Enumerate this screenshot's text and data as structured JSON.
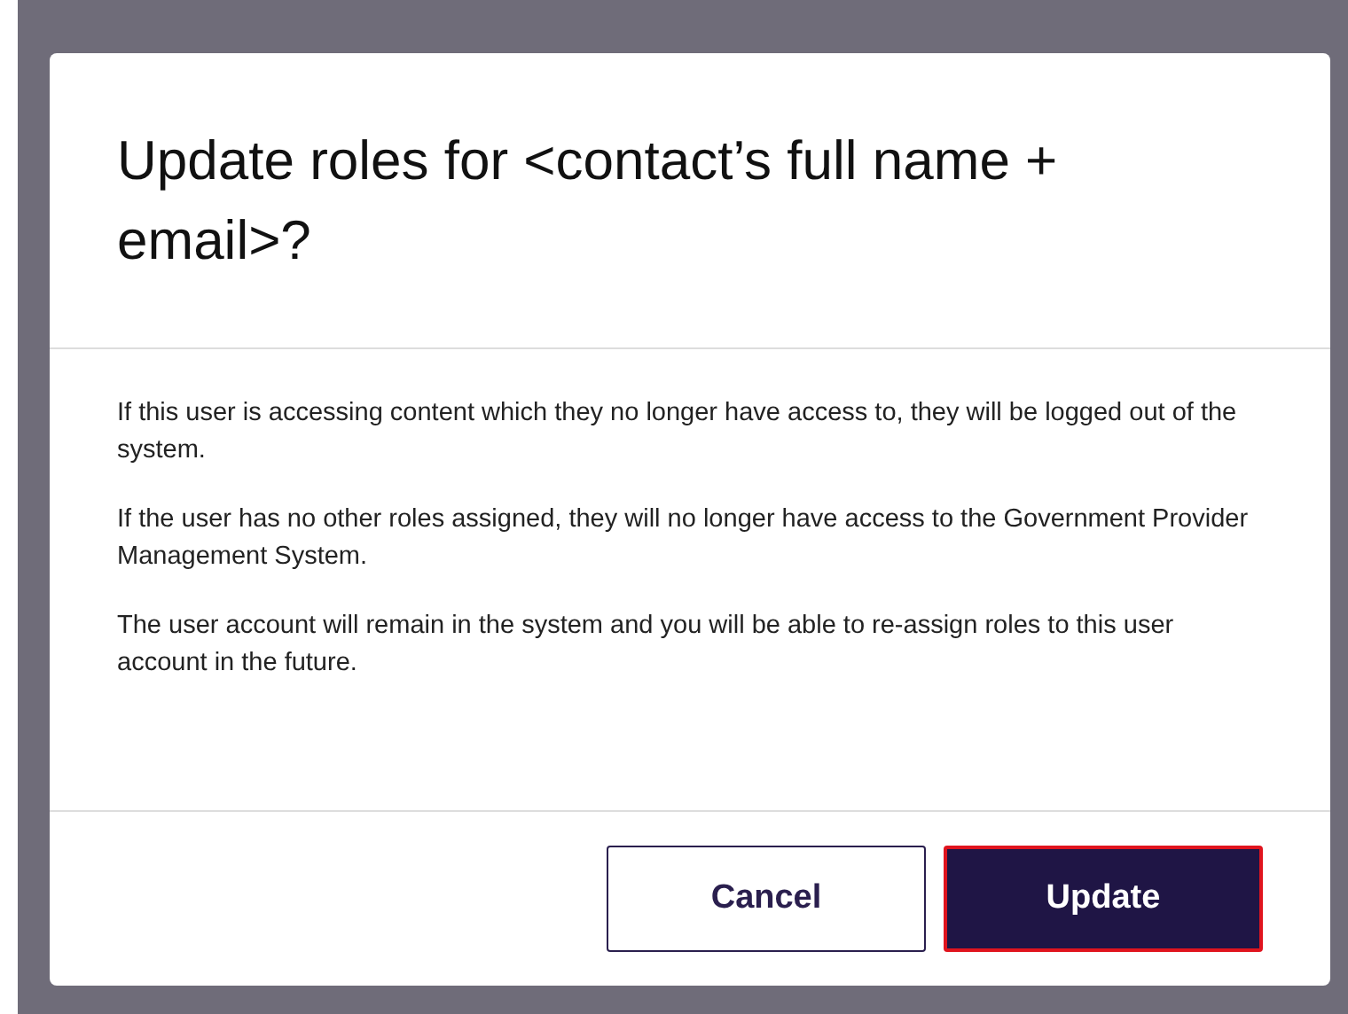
{
  "dialog": {
    "title": "Update roles for <contact’s full name + email>?",
    "paragraphs": [
      "If this user is accessing content which they no longer have access to, they will be logged out of the system.",
      "If the user has no other roles assigned, they will no longer have access to the Government Provider Management System.",
      "The user account will remain in the system and you will be able to re-assign roles to this user account in the future."
    ],
    "buttons": [
      {
        "label": "Cancel",
        "kind": "secondary",
        "focused": false
      },
      {
        "label": "Update",
        "kind": "primary",
        "focused": true
      }
    ]
  }
}
